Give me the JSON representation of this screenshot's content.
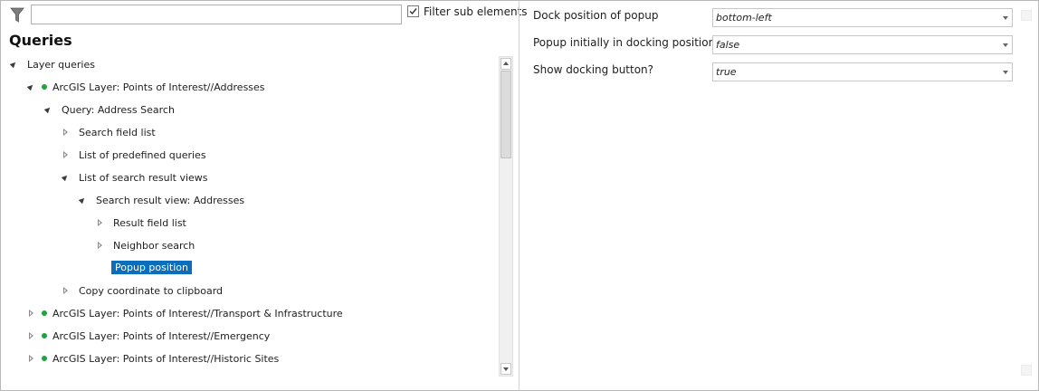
{
  "filter": {
    "placeholder": "",
    "value": "",
    "sub_elements_label": "Filter sub elements",
    "sub_elements_checked": true
  },
  "queries_title": "Queries",
  "tree": [
    {
      "label": "Layer queries",
      "state": "open",
      "dot": false,
      "level": 0
    },
    {
      "label": "ArcGIS Layer: Points of Interest//Addresses",
      "state": "open",
      "dot": true,
      "level": 1
    },
    {
      "label": "Query: Address Search",
      "state": "open",
      "dot": false,
      "level": 2
    },
    {
      "label": "Search field list",
      "state": "closed",
      "dot": false,
      "level": 3
    },
    {
      "label": "List of predefined queries",
      "state": "closed",
      "dot": false,
      "level": 3
    },
    {
      "label": "List of search result views",
      "state": "open",
      "dot": false,
      "level": 3
    },
    {
      "label": "Search result view: Addresses",
      "state": "open",
      "dot": false,
      "level": 4
    },
    {
      "label": "Result field list",
      "state": "closed",
      "dot": false,
      "level": 5
    },
    {
      "label": "Neighbor search",
      "state": "closed",
      "dot": false,
      "level": 5
    },
    {
      "label": "Popup position",
      "state": "leaf",
      "dot": false,
      "level": 5,
      "selected": true
    },
    {
      "label": "Copy coordinate to clipboard",
      "state": "closed",
      "dot": false,
      "level": 3
    },
    {
      "label": "ArcGIS Layer: Points of Interest//Transport & Infrastructure",
      "state": "closed",
      "dot": true,
      "level": 1
    },
    {
      "label": "ArcGIS Layer: Points of Interest//Emergency",
      "state": "closed",
      "dot": true,
      "level": 1
    },
    {
      "label": "ArcGIS Layer: Points of Interest//Historic Sites",
      "state": "closed",
      "dot": true,
      "level": 1
    }
  ],
  "properties": [
    {
      "label": "Dock position of popup",
      "value": "bottom-left"
    },
    {
      "label": "Popup initially in docking position?",
      "value": "false"
    },
    {
      "label": "Show docking button?",
      "value": "true"
    }
  ],
  "colors": {
    "selection": "#0a6ebd",
    "layer_dot": "#1aa63a"
  }
}
